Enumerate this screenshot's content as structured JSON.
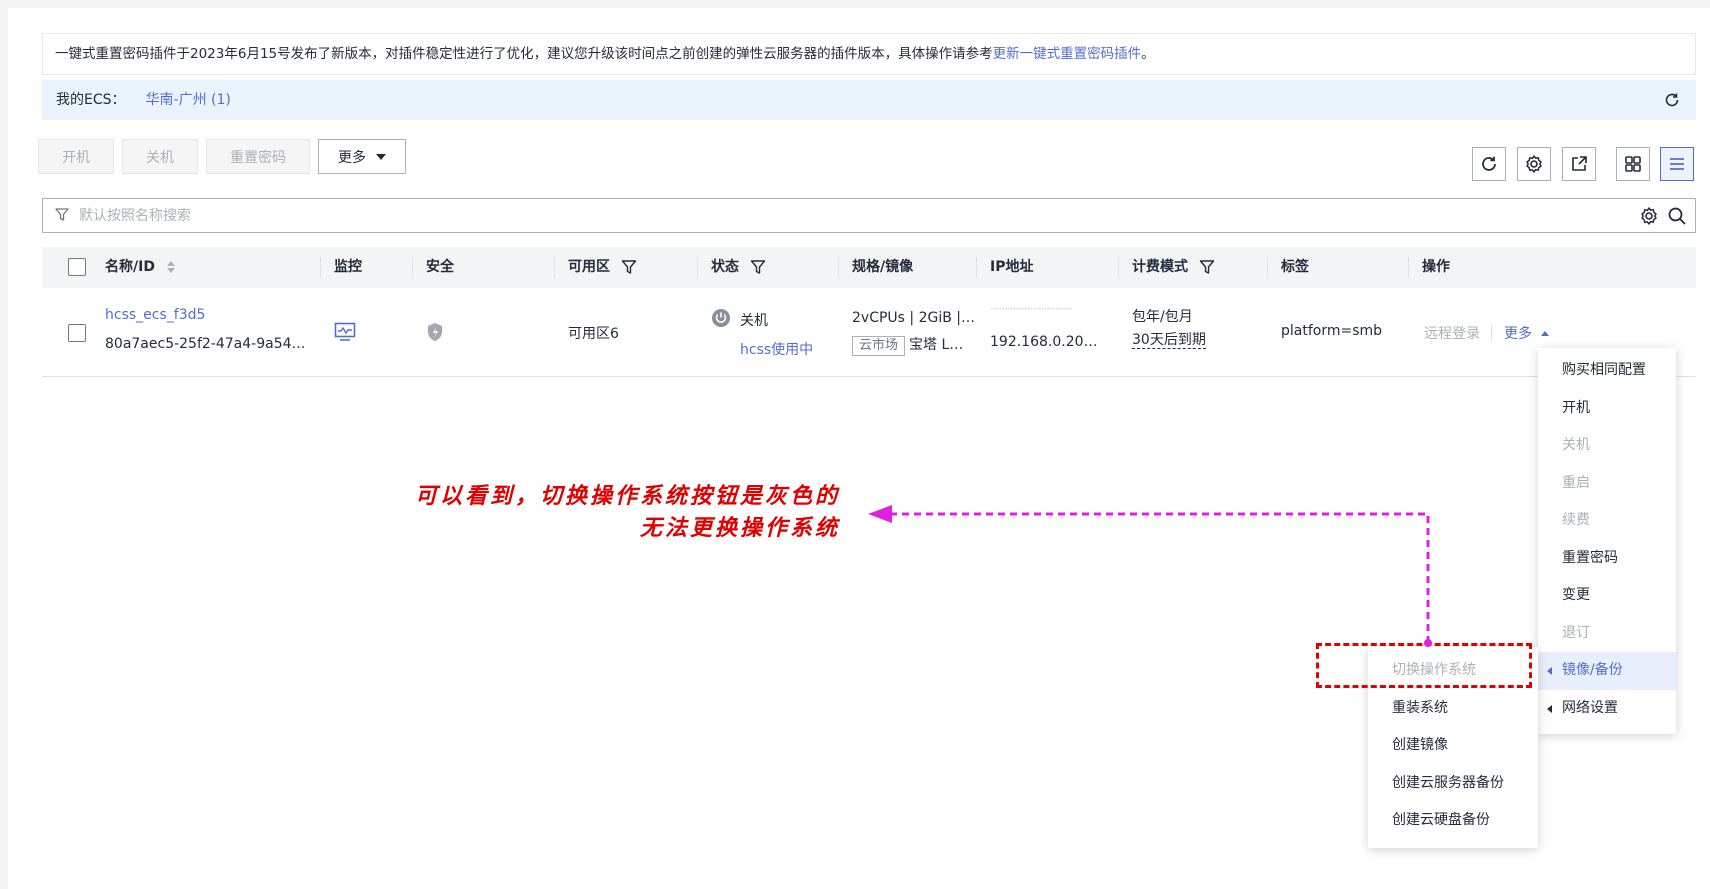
{
  "notice": {
    "text": "一键式重置密码插件于2023年6月15号发布了新版本，对插件稳定性进行了优化，建议您升级该时间点之前创建的弹性云服务器的插件版本，具体操作请参考",
    "link": "更新一键式重置密码插件",
    "suffix": "。"
  },
  "ecs_bar": {
    "label": "我的ECS：",
    "region": "华南-广州 (1)"
  },
  "toolbar": {
    "start": "开机",
    "stop": "关机",
    "reset_password": "重置密码",
    "more": "更多"
  },
  "search": {
    "placeholder": "默认按照名称搜索"
  },
  "table": {
    "headers": {
      "name": "名称/ID",
      "monitor": "监控",
      "security": "安全",
      "az": "可用区",
      "status": "状态",
      "spec": "规格/镜像",
      "ip": "IP地址",
      "billing": "计费模式",
      "tag": "标签",
      "ops": "操作"
    },
    "row": {
      "name": "hcss_ecs_f3d5",
      "id": "80a7aec5-25f2-47a4-9a54…",
      "az": "可用区6",
      "status": "关机",
      "status_sub": "hcss使用中",
      "spec": "2vCPUs | 2GiB |…",
      "image_tag": "云市场",
      "image": "宝塔 L…",
      "ip_public": "·····························",
      "ip_private": "192.168.0.20…",
      "billing": "包年/包月",
      "billing_sub": "30天后到期",
      "tag": "platform=smb",
      "remote_login": "远程登录",
      "more": "更多"
    }
  },
  "menu_main": [
    {
      "label": "购买相同配置",
      "state": "normal"
    },
    {
      "label": "开机",
      "state": "normal"
    },
    {
      "label": "关机",
      "state": "disabled"
    },
    {
      "label": "重启",
      "state": "disabled"
    },
    {
      "label": "续费",
      "state": "disabled"
    },
    {
      "label": "重置密码",
      "state": "normal"
    },
    {
      "label": "变更",
      "state": "normal"
    },
    {
      "label": "退订",
      "state": "disabled"
    },
    {
      "label": "镜像/备份",
      "state": "highlighted"
    },
    {
      "label": "网络设置",
      "state": "normal"
    }
  ],
  "menu_sub": [
    {
      "label": "切换操作系统",
      "state": "disabled"
    },
    {
      "label": "重装系统",
      "state": "normal"
    },
    {
      "label": "创建镜像",
      "state": "normal"
    },
    {
      "label": "创建云服务器备份",
      "state": "normal"
    },
    {
      "label": "创建云硬盘备份",
      "state": "normal"
    }
  ],
  "annotation": {
    "line1": "可以看到，切换操作系统按钮是灰色的",
    "line2": "无法更换操作系统"
  },
  "colors": {
    "link": "#526ecc",
    "annotation": "#e00000",
    "arrow": "#e020e0",
    "disabled": "#adb0b8"
  }
}
